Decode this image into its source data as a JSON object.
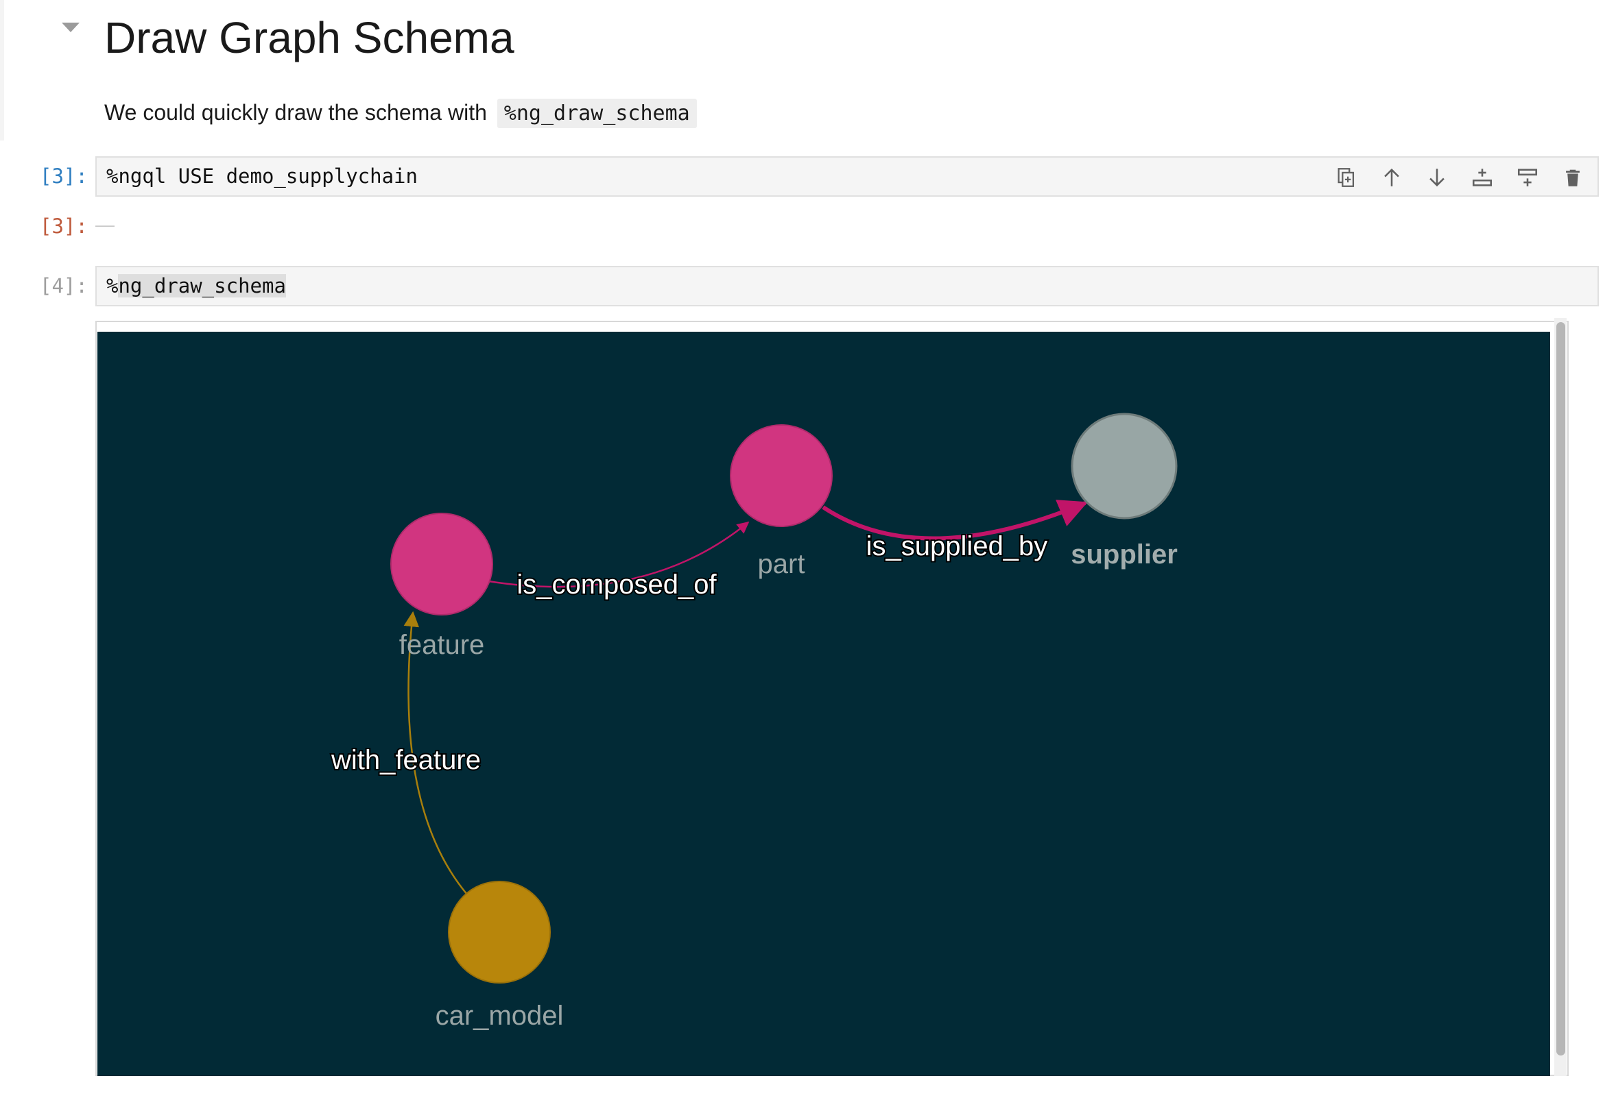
{
  "section": {
    "title": "Draw Graph Schema",
    "description_prefix": "We could quickly draw the schema with",
    "description_code": "%ng_draw_schema"
  },
  "cells": [
    {
      "input_prompt": "[3]:",
      "code": "%ngql USE demo_supplychain",
      "output_prompt": "[3]:"
    },
    {
      "input_prompt": "[4]:",
      "code_prefix": "%",
      "code_highlight": "ng_draw_schema"
    }
  ],
  "toolbar": {
    "icons": [
      "duplicate-icon",
      "move-up-icon",
      "move-down-icon",
      "insert-below-icon",
      "insert-above-icon",
      "delete-icon"
    ]
  },
  "graph": {
    "background": "#022a36",
    "nodes": [
      {
        "id": "feature",
        "label": "feature",
        "color": "#d13580"
      },
      {
        "id": "part",
        "label": "part",
        "color": "#d13580"
      },
      {
        "id": "supplier",
        "label": "supplier",
        "color": "#98a6a5"
      },
      {
        "id": "car_model",
        "label": "car_model",
        "color": "#b8860b"
      }
    ],
    "edges": [
      {
        "from": "feature",
        "to": "part",
        "label": "is_composed_of",
        "color": "#c11468"
      },
      {
        "from": "part",
        "to": "supplier",
        "label": "is_supplied_by",
        "color": "#c11468"
      },
      {
        "from": "car_model",
        "to": "feature",
        "label": "with_feature",
        "color": "#a87f0c"
      }
    ]
  }
}
